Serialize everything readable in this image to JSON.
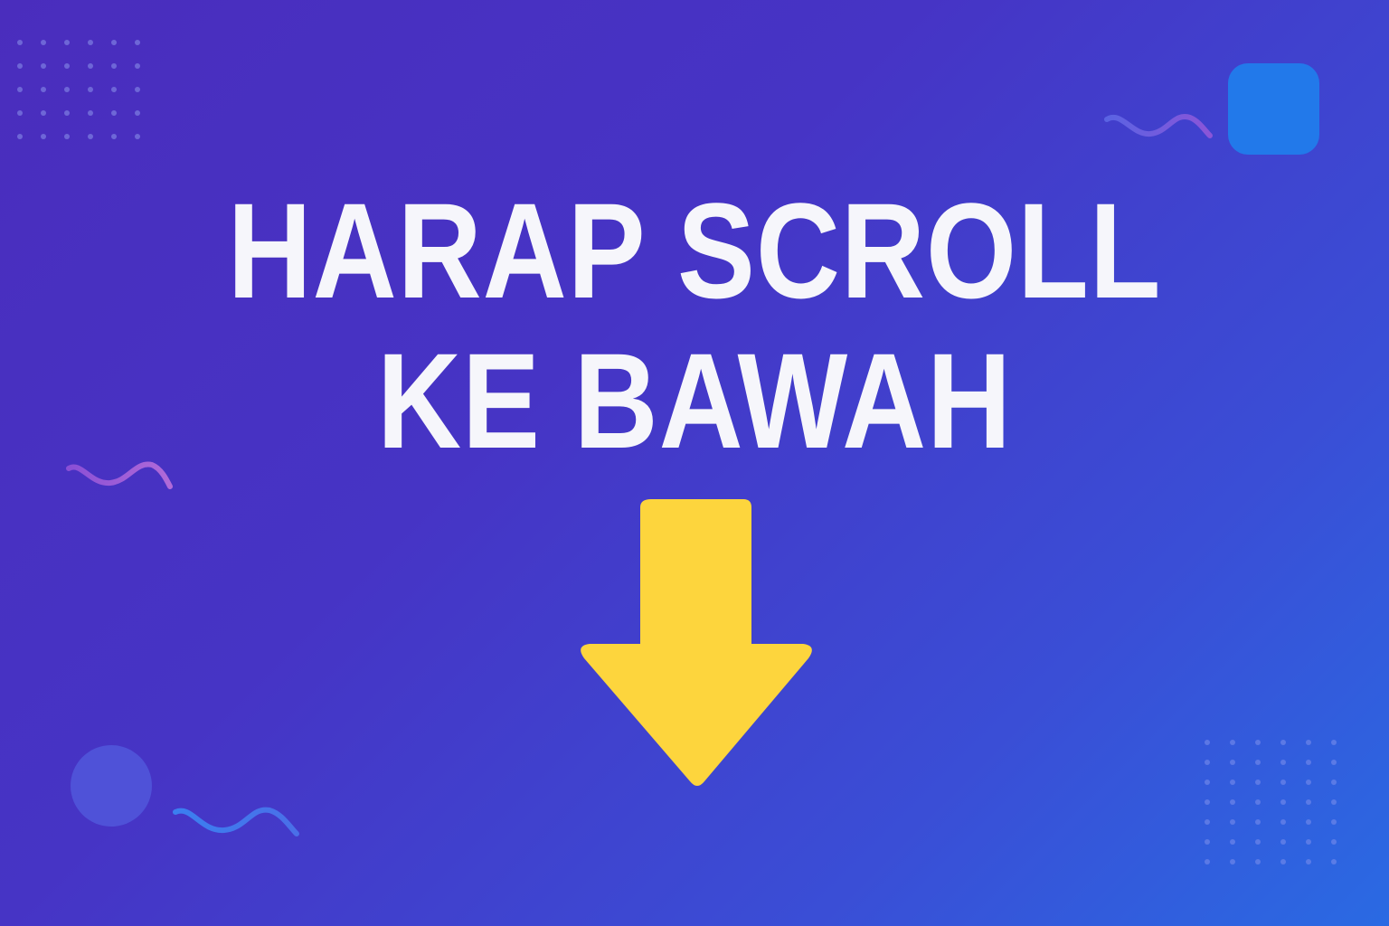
{
  "headline": {
    "line1": "HARAP SCROLL",
    "line2": "KE BAWAH"
  },
  "icons": {
    "main_arrow": "arrow-down-icon"
  },
  "colors": {
    "background_start": "#4a2dbd",
    "background_end": "#2a6ae3",
    "text": "#f6f6fb",
    "arrow": "#fdd53d",
    "accent_square": "#2279ea",
    "accent_circle": "#4f52d8"
  }
}
